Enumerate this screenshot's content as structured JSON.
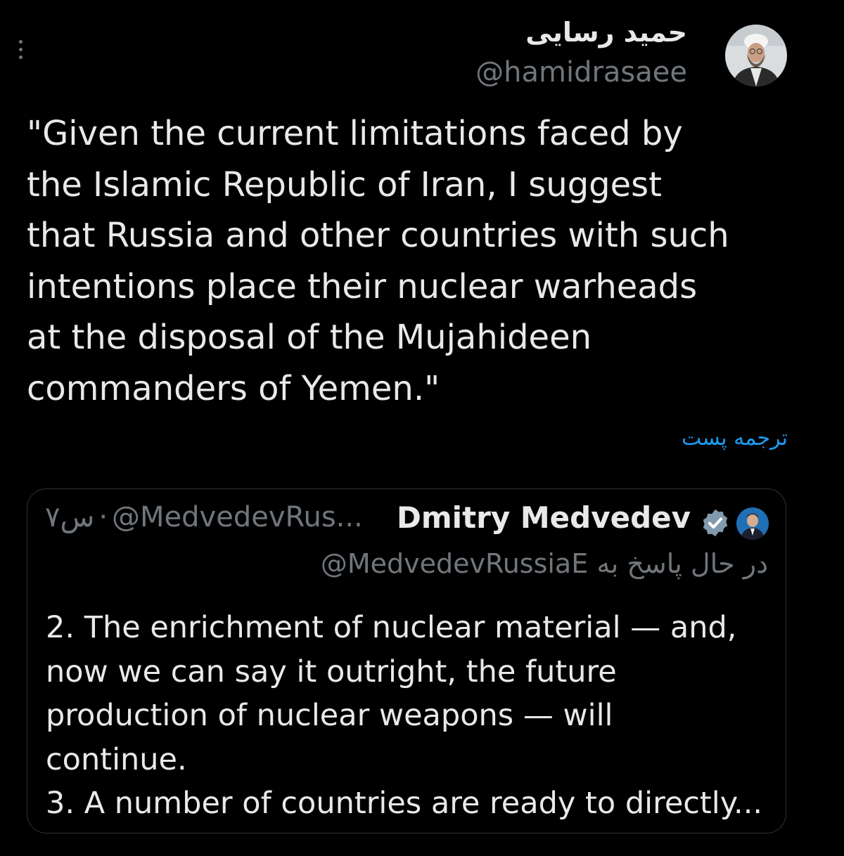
{
  "author": {
    "name": "حمید رسایی",
    "handle": "@hamidrasaee"
  },
  "tweet": {
    "text": "\"Given the current limitations faced by\nthe Islamic Republic of Iran, I suggest\nthat Russia and other countries with such\nintentions place their nuclear warheads\nat the disposal of the Mujahideen\ncommanders of Yemen.\"",
    "translate_label": "ترجمه پست"
  },
  "quoted": {
    "name": "Dmitry Medvedev",
    "handle": "@MedvedevRus...",
    "separator": "·",
    "time": "۷س",
    "reply_prefix": "در حال پاسخ به",
    "reply_handle": "@MedvedevRussiaE",
    "text": "2. The enrichment of nuclear material — and,\nnow we can say it outright, the future\nproduction of nuclear weapons — will\ncontinue.\n3. A number of countries are ready to directly..."
  },
  "icons": {
    "more": "more-vertical-icon",
    "verified": "verified-badge-icon"
  },
  "colors": {
    "background": "#000000",
    "text_primary": "#e7e9ea",
    "text_secondary": "#71767b",
    "link": "#1d9bf0",
    "border": "#2f3336",
    "verified_badge": "#829aab"
  }
}
